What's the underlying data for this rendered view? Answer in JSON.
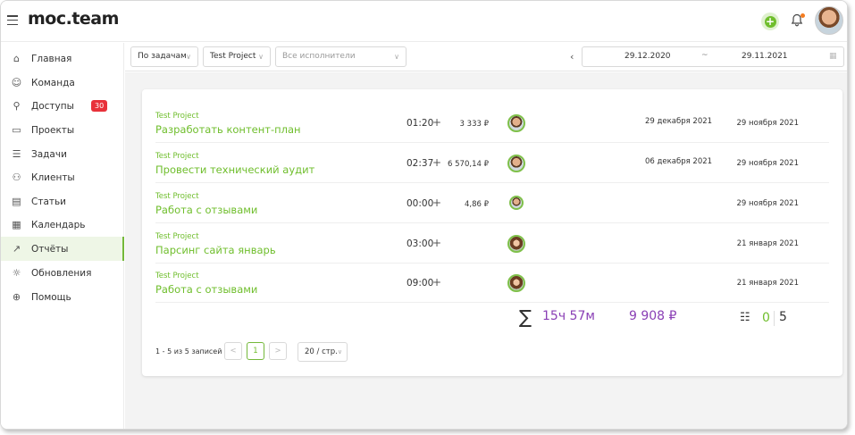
{
  "app": {
    "logo": "moc.team"
  },
  "header": {
    "add_icon": "plus-circle-icon",
    "bell_icon": "bell-icon",
    "accent": "#6fbe2c"
  },
  "sidebar": {
    "items": [
      {
        "icon": "⌂",
        "label": "Главная"
      },
      {
        "icon": "☺",
        "label": "Команда"
      },
      {
        "icon": "⚲",
        "label": "Доступы",
        "badge": "30"
      },
      {
        "icon": "▭",
        "label": "Проекты"
      },
      {
        "icon": "☰",
        "label": "Задачи"
      },
      {
        "icon": "⚇",
        "label": "Клиенты"
      },
      {
        "icon": "▤",
        "label": "Статьи"
      },
      {
        "icon": "▦",
        "label": "Календарь"
      },
      {
        "icon": "↗",
        "label": "Отчёты",
        "active": true
      },
      {
        "icon": "☼",
        "label": "Обновления"
      },
      {
        "icon": "⊕",
        "label": "Помощь"
      }
    ]
  },
  "filters": {
    "group_by": "По задачам",
    "project": "Test Project",
    "assignee_placeholder": "Все исполнители",
    "date_from": "29.12.2020",
    "date_sep": "~",
    "date_to": "29.11.2021"
  },
  "rows": [
    {
      "project": "Test Project",
      "task": "Разработать контент-план",
      "time": "01:20",
      "cost": "3 333 ₽",
      "avatar": "m",
      "deadline": "29 декабря 2021",
      "created": "29 ноября 2021"
    },
    {
      "project": "Test Project",
      "task": "Провести технический аудит",
      "time": "02:37",
      "cost": "6 570,14 ₽",
      "avatar": "m",
      "deadline": "06 декабря 2021",
      "created": "29 ноября 2021"
    },
    {
      "project": "Test Project",
      "task": "Работа с отзывами",
      "time": "00:00",
      "cost": "4,86 ₽",
      "avatar": "m-small",
      "deadline": "",
      "created": "29 ноября 2021"
    },
    {
      "project": "Test Project",
      "task": "Парсинг сайта январь",
      "time": "03:00",
      "cost": "",
      "avatar": "f",
      "deadline": "",
      "created": "21 января 2021"
    },
    {
      "project": "Test Project",
      "task": "Работа с отзывами",
      "time": "09:00",
      "cost": "",
      "avatar": "f",
      "deadline": "",
      "created": "21 января 2021"
    }
  ],
  "totals": {
    "sigma": "∑",
    "time": "15ч 57м",
    "money": "9 908 ₽",
    "tasks_icon": "☷",
    "done": "0",
    "count": "5"
  },
  "pagination": {
    "info": "1 - 5 из 5 записей",
    "prev": "<",
    "page": "1",
    "next": ">",
    "page_size": "20 / стр."
  }
}
